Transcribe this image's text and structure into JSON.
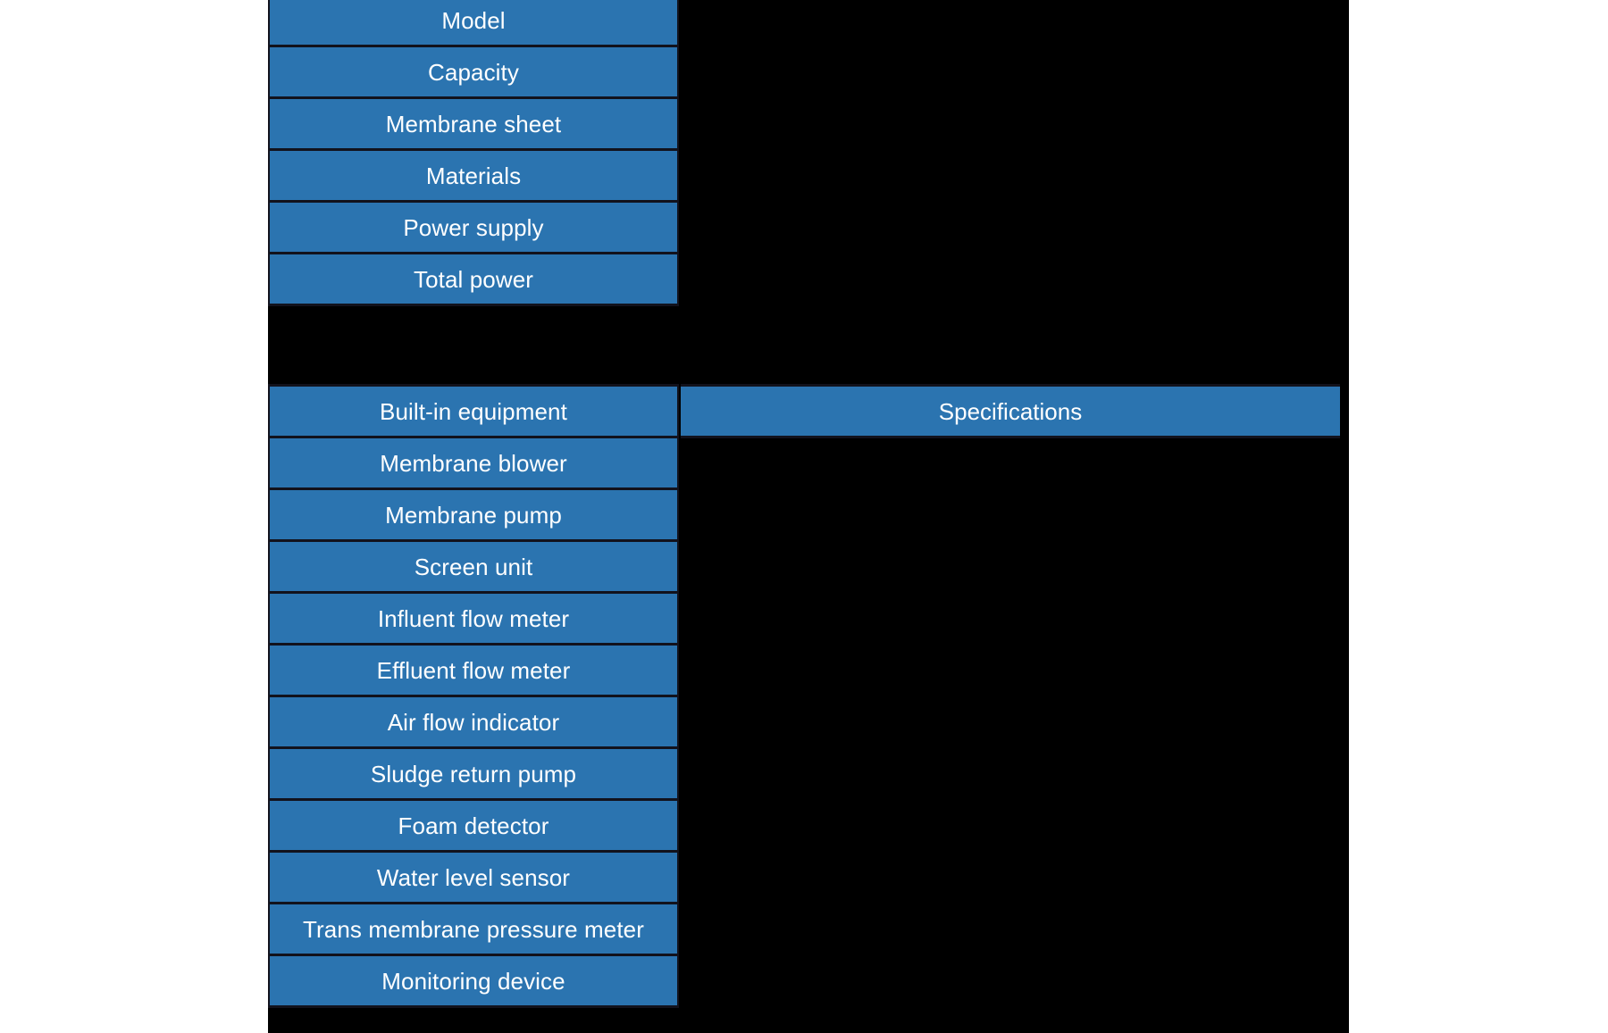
{
  "colors": {
    "row_fill": "#2B74B0",
    "row_border": "#12121c",
    "row_text": "#ffffff",
    "panel_background": "#000000",
    "page_background": "#ffffff"
  },
  "top_table": {
    "name": "unit-specification-table",
    "rows": [
      {
        "label": "Model",
        "value": ""
      },
      {
        "label": "Capacity",
        "value": ""
      },
      {
        "label": "Membrane sheet",
        "value": ""
      },
      {
        "label": "Materials",
        "value": ""
      },
      {
        "label": "Power supply",
        "value": ""
      },
      {
        "label": "Total power",
        "value": ""
      }
    ]
  },
  "bottom_table": {
    "name": "built-in-equipment-table",
    "header": {
      "label_column": "Built-in equipment",
      "value_column": "Specifications"
    },
    "rows": [
      {
        "label": "Membrane blower",
        "value": ""
      },
      {
        "label": "Membrane pump",
        "value": ""
      },
      {
        "label": "Screen unit",
        "value": ""
      },
      {
        "label": "Influent flow meter",
        "value": ""
      },
      {
        "label": "Effluent flow meter",
        "value": ""
      },
      {
        "label": "Air flow indicator",
        "value": ""
      },
      {
        "label": "Sludge return pump",
        "value": ""
      },
      {
        "label": "Foam detector",
        "value": ""
      },
      {
        "label": "Water level sensor",
        "value": ""
      },
      {
        "label": "Trans membrane pressure meter",
        "value": ""
      },
      {
        "label": "Monitoring device",
        "value": ""
      }
    ]
  }
}
